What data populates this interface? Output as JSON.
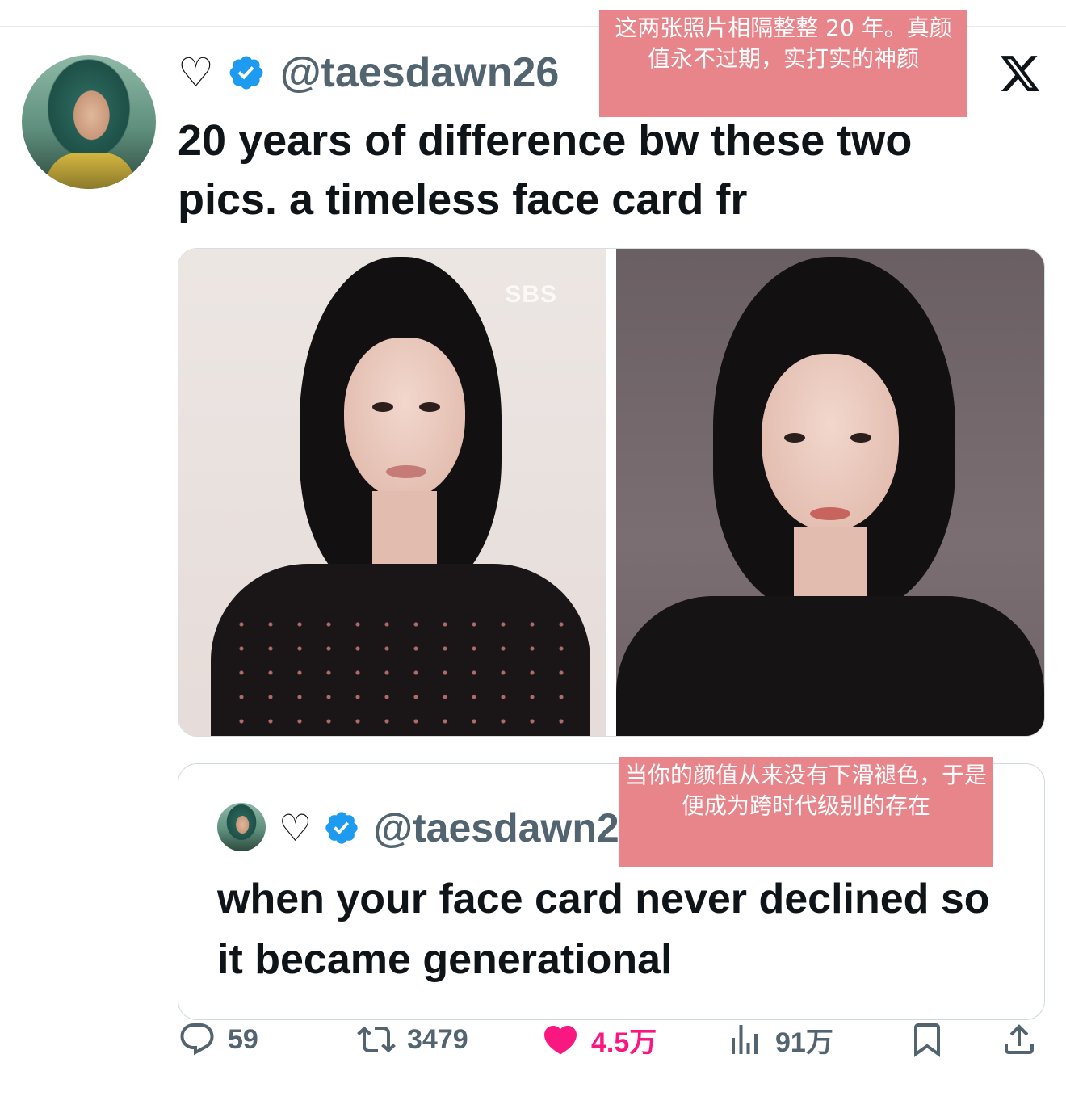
{
  "tweet": {
    "handle": "@taesdawn26",
    "text": "20 years of difference bw these two pics. a timeless face card fr",
    "media": {
      "watermark": "SBS"
    }
  },
  "quoted_tweet": {
    "handle": "@taesdawn26",
    "text": "when your face card never declined so it became generational"
  },
  "overlays": {
    "caption_1": "这两张照片相隔整整 20 年。真颜值永不过期，实打实的神颜",
    "caption_2": "当你的颜值从来没有下滑褪色，于是便成为跨时代级别的存在"
  },
  "actions": {
    "replies": "59",
    "reposts": "3479",
    "likes": "4.5万",
    "views": "91万"
  },
  "colors": {
    "text": "#0f1419",
    "secondary": "#536471",
    "verified": "#1d9bf0",
    "like": "#f91880",
    "overlay": "#e8858a"
  },
  "icons": [
    "heart-outline-icon",
    "verified-badge-icon",
    "x-logo-icon",
    "reply-icon",
    "repost-icon",
    "like-icon",
    "views-icon",
    "bookmark-icon",
    "share-icon"
  ]
}
